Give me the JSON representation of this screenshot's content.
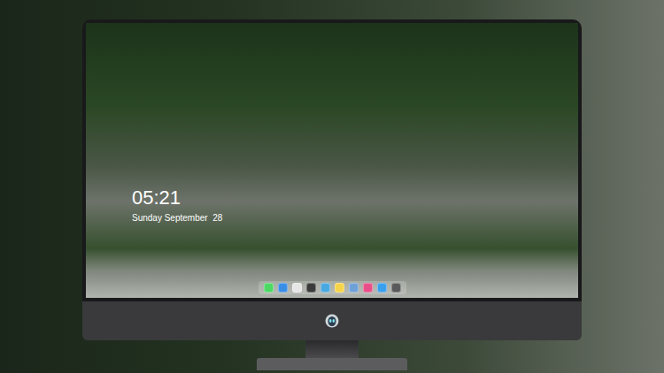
{
  "screen": {
    "clock": "05:21",
    "date": "Sunday September  28"
  },
  "dock": {
    "items": [
      {
        "color": "#4cd964"
      },
      {
        "color": "#3a8ee6"
      },
      {
        "color": "#e6e6e6"
      },
      {
        "color": "#3a3a3a"
      },
      {
        "color": "#4aa8e0"
      },
      {
        "color": "#f6d44a"
      },
      {
        "color": "#6fa0d8"
      },
      {
        "color": "#e94d8a"
      },
      {
        "color": "#3aa0ee"
      },
      {
        "color": "#5a5a5a"
      }
    ]
  }
}
